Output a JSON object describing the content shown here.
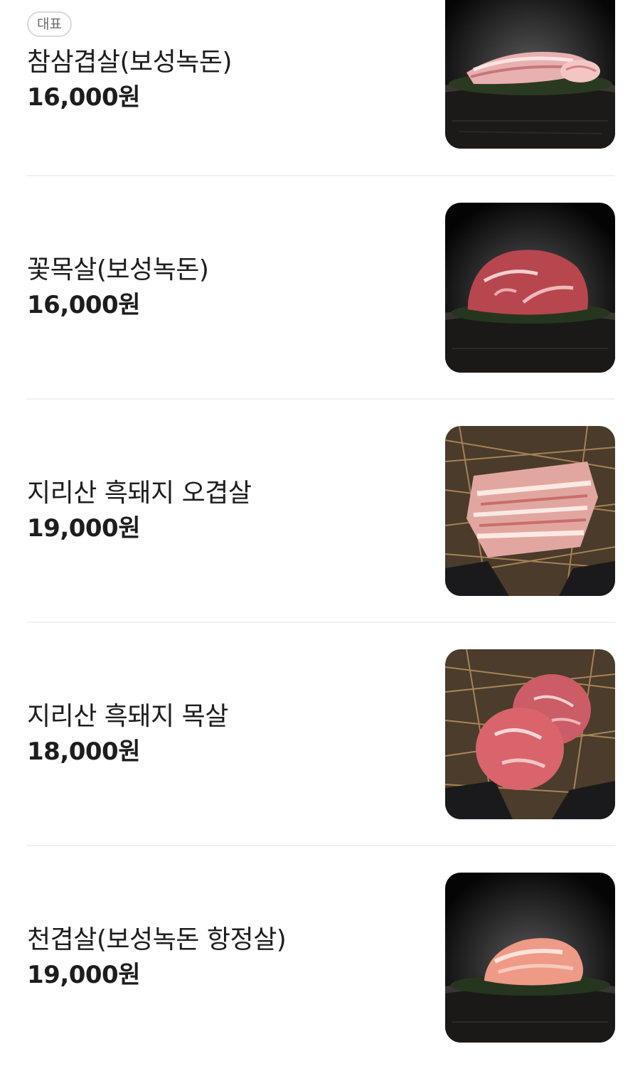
{
  "menu": {
    "items": [
      {
        "badge": "대표",
        "name": "참삼겹살(보성녹돈)",
        "price": "16,000원",
        "image": "pork-belly-on-wood-stump-photo"
      },
      {
        "name": "꽃목살(보성녹돈)",
        "price": "16,000원",
        "image": "pork-neck-on-wood-stump-photo"
      },
      {
        "name": "지리산 흑돼지 오겹살",
        "price": "19,000원",
        "image": "pork-belly-on-straw-photo"
      },
      {
        "name": "지리산 흑돼지 목살",
        "price": "18,000원",
        "image": "pork-neck-on-straw-photo"
      },
      {
        "name": "천겹살(보성녹돈 항정살)",
        "price": "19,000원",
        "image": "pork-jowl-on-wood-stump-photo"
      }
    ]
  }
}
